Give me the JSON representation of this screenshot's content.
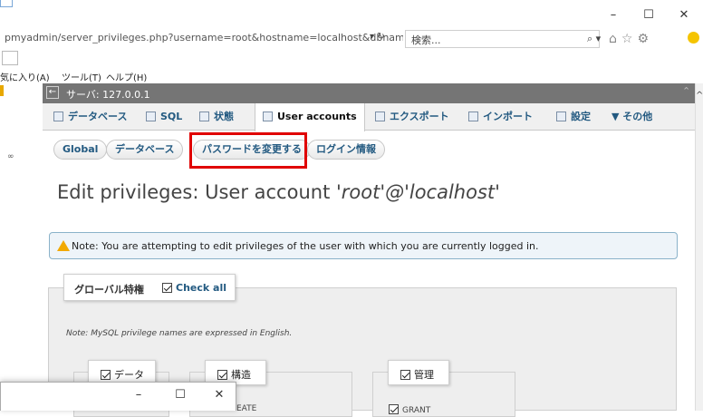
{
  "browser": {
    "url": "pmyadmin/server_privileges.php?username=root&hostname=localhost&dbname=&tabler",
    "url_dropdown": "▾ ↻",
    "search_placeholder": "検索...",
    "search_button": "⌕ ▾",
    "nav_icons": [
      "home-icon",
      "star-icon",
      "gear-icon"
    ],
    "window_buttons": {
      "minimize": "–",
      "maximize": "☐",
      "close": "✕"
    },
    "menu": [
      "気に入り(A)",
      "ツール(T)",
      "ヘルプ(H)"
    ]
  },
  "pma": {
    "server_label": "サーバ: 127.0.0.1",
    "back": "←",
    "collapse": "⌃",
    "tabs": [
      {
        "label": "データベース",
        "icon": "database-icon"
      },
      {
        "label": "SQL",
        "icon": "sql-icon"
      },
      {
        "label": "状態",
        "icon": "status-icon"
      },
      {
        "label": "User accounts",
        "icon": "users-icon"
      },
      {
        "label": "エクスポート",
        "icon": "export-icon"
      },
      {
        "label": "インポート",
        "icon": "import-icon"
      },
      {
        "label": "設定",
        "icon": "settings-icon"
      },
      {
        "label": "▼ その他",
        "icon": "more-icon"
      }
    ],
    "subtabs": [
      "Global",
      "データベース",
      "パスワードを変更する",
      "ログイン情報"
    ],
    "heading_prefix": "Edit privileges: User account ",
    "heading_account": "'root'@'localhost'",
    "notice": "Note: You are attempting to edit privileges of the user with which you are currently logged in.",
    "global_legend": "グローバル特権",
    "check_all": "Check all",
    "mysql_note": "Note: MySQL privilege names are expressed in English.",
    "groups": [
      "データ",
      "構造",
      "管理"
    ],
    "partial_items": [
      "EATE",
      "GRANT"
    ]
  },
  "popup": {
    "window_buttons": {
      "minimize": "–",
      "maximize": "☐",
      "close": "✕"
    }
  },
  "colors": {
    "highlight": "#e00000",
    "server_bar": "#757575",
    "link": "#235a81"
  }
}
